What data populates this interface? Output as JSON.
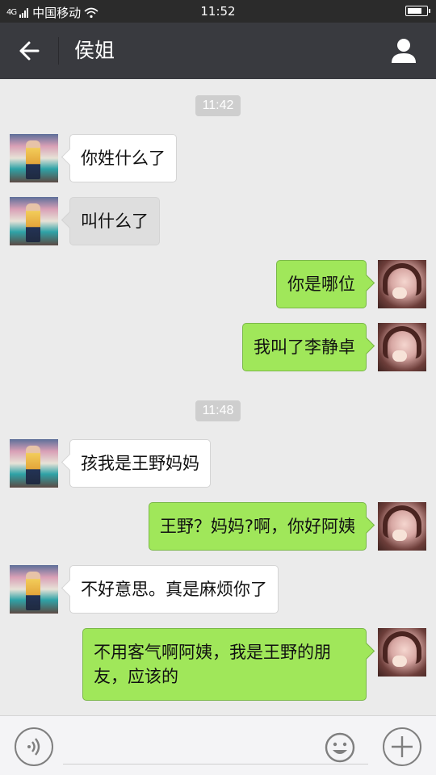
{
  "status_bar": {
    "signal": "4G",
    "carrier": "中国移动",
    "time": "11:52"
  },
  "header": {
    "title": "侯姐"
  },
  "messages": [
    {
      "kind": "timestamp",
      "text": "11:42"
    },
    {
      "kind": "incoming",
      "text": "你姓什么了",
      "sender": "mom"
    },
    {
      "kind": "incoming",
      "text": "叫什么了",
      "sender": "mom"
    },
    {
      "kind": "outgoing",
      "text": "你是哪位",
      "sender": "me"
    },
    {
      "kind": "outgoing",
      "text": "我叫了李静卓",
      "sender": "me"
    },
    {
      "kind": "timestamp",
      "text": "11:48"
    },
    {
      "kind": "incoming",
      "text": "孩我是王野妈妈",
      "sender": "mom"
    },
    {
      "kind": "outgoing",
      "text": "王野？妈妈?啊，你好阿姨",
      "sender": "me"
    },
    {
      "kind": "incoming",
      "text": "不好意思。真是麻烦你了",
      "sender": "mom"
    },
    {
      "kind": "outgoing",
      "text": "不用客气啊阿姨，我是王野的朋友，应该的",
      "sender": "me"
    }
  ],
  "input": {
    "value": "",
    "placeholder": ""
  },
  "icons": {
    "back": "arrow-left-icon",
    "profile": "person-icon",
    "voice": "voice-icon",
    "emoji": "smiley-icon",
    "plus": "plus-icon",
    "wifi": "wifi-icon",
    "battery": "battery-icon"
  },
  "colors": {
    "status_bar": "#2b2b2b",
    "nav_bar": "#393a3f",
    "chat_background": "#ebebeb",
    "outgoing_bubble": "#a0e75a",
    "incoming_bubble": "#ffffff",
    "timestamp_pill": "#cecece"
  }
}
